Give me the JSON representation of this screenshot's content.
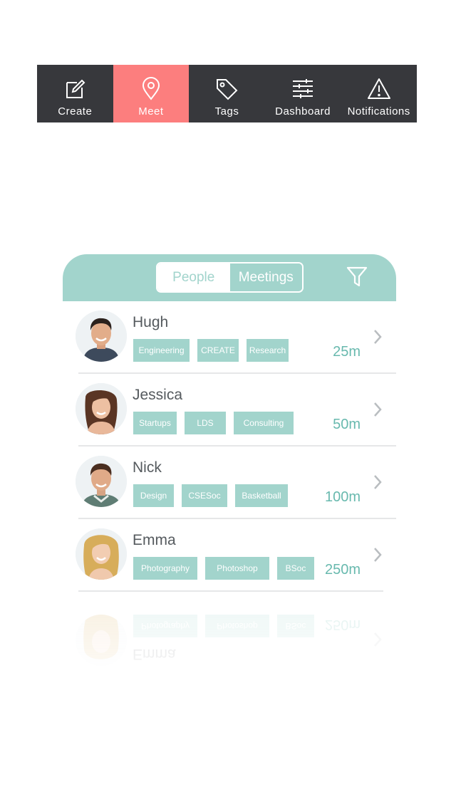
{
  "nav": {
    "items": [
      {
        "label": "Create",
        "icon": "edit-icon",
        "active": false
      },
      {
        "label": "Meet",
        "icon": "location-pin-icon",
        "active": true
      },
      {
        "label": "Tags",
        "icon": "tag-icon",
        "active": false
      },
      {
        "label": "Dashboard",
        "icon": "sliders-icon",
        "active": false
      },
      {
        "label": "Notifications",
        "icon": "warning-icon",
        "active": false
      }
    ]
  },
  "segment": {
    "people_label": "People",
    "meetings_label": "Meetings",
    "selected": "Meetings"
  },
  "list": [
    {
      "name": "Hugh",
      "tags": [
        "Engineering",
        "CREATE",
        "Research"
      ],
      "distance": "25m"
    },
    {
      "name": "Jessica",
      "tags": [
        "Startups",
        "LDS",
        "Consulting"
      ],
      "distance": "50m"
    },
    {
      "name": "Nick",
      "tags": [
        "Design",
        "CSESoc",
        "Basketball"
      ],
      "distance": "100m"
    },
    {
      "name": "Emma",
      "tags": [
        "Photography",
        "Photoshop",
        "BSoc"
      ],
      "distance": "250m"
    }
  ],
  "colors": {
    "nav_bg": "#37383c",
    "nav_active": "#fc7e7e",
    "accent": "#a2d4cc",
    "distance_text": "#68b9ae"
  }
}
